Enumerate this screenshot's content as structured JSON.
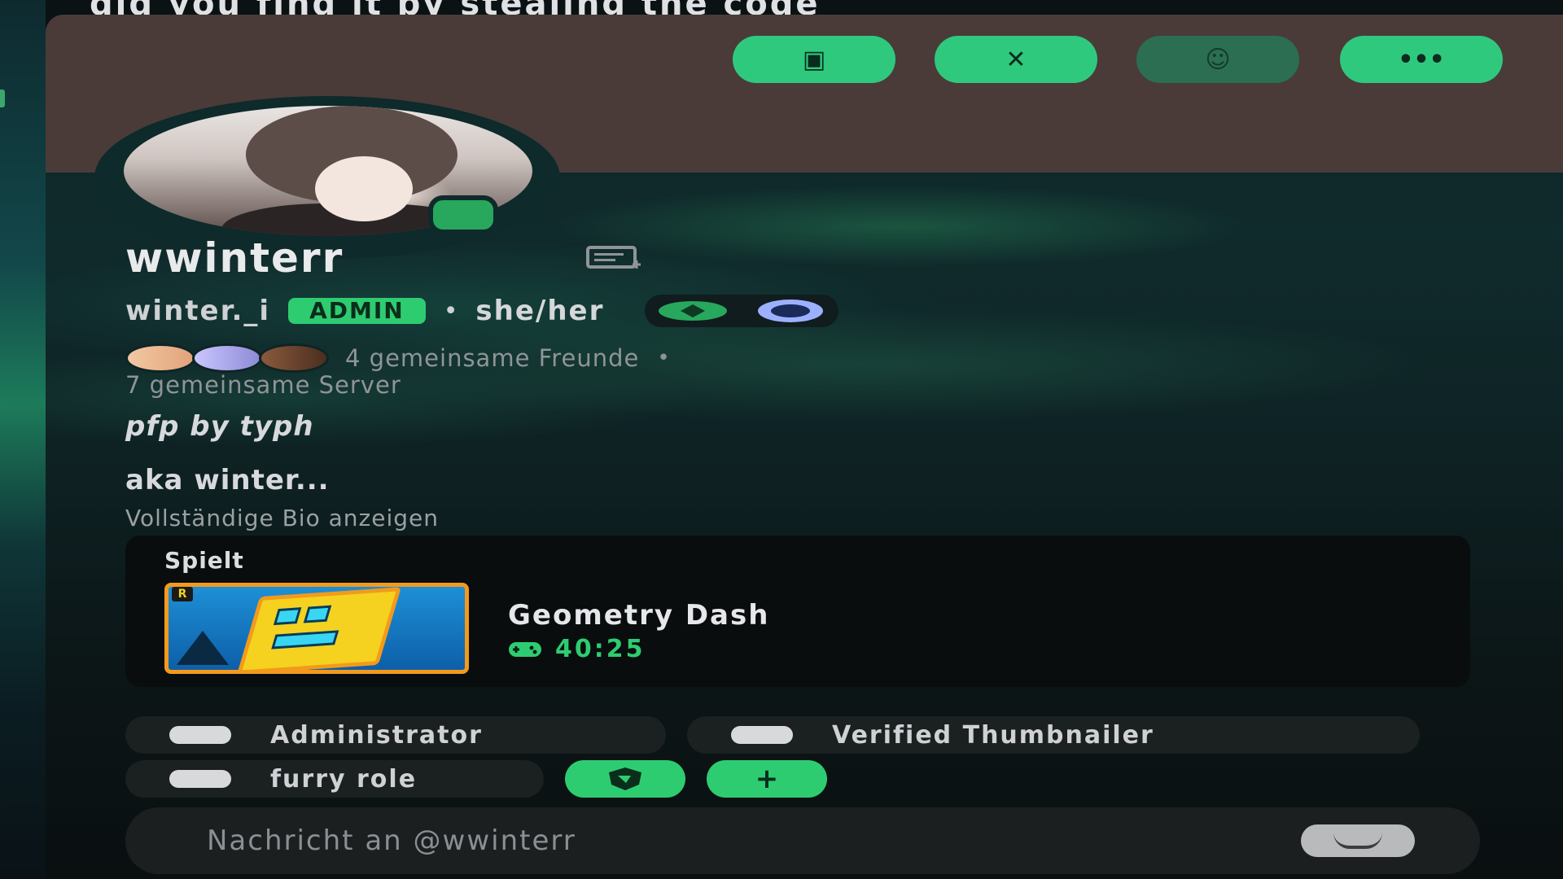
{
  "background_message": {
    "text": "did you find it by stealing the code"
  },
  "banner": {
    "color": "#4a3b38",
    "actions": [
      {
        "name": "clipboard-icon",
        "glyph": "▣"
      },
      {
        "name": "x-logo-icon",
        "glyph": "✕"
      },
      {
        "name": "add-friend-icon",
        "glyph": "☺"
      },
      {
        "name": "more-icon",
        "glyph": "•••"
      }
    ]
  },
  "profile": {
    "display_name": "wwinterr",
    "username": "winter._i",
    "role_tag": "ADMIN",
    "separator": "•",
    "pronouns": "she/her",
    "status_color": "#27a85d",
    "mutual_friends": "4 gemeinsame Freunde",
    "mutual_separator": "•",
    "mutual_servers": "7 gemeinsame Server",
    "bio_line1": "pfp by typh",
    "bio_line2": "aka winter...",
    "show_full_bio": "Vollständige Bio anzeigen"
  },
  "activity": {
    "label": "Spielt",
    "game": "Geometry Dash",
    "elapsed": "40:25",
    "cover_badge": "R"
  },
  "roles": [
    {
      "label": "Administrator"
    },
    {
      "label": "Verified Thumbnailer"
    },
    {
      "label": "furry role"
    }
  ],
  "role_actions": {
    "add_label": "+"
  },
  "message": {
    "placeholder": "Nachricht an @wwinterr"
  },
  "colors": {
    "accent": "#2ecc71",
    "background": "#0b1214"
  }
}
